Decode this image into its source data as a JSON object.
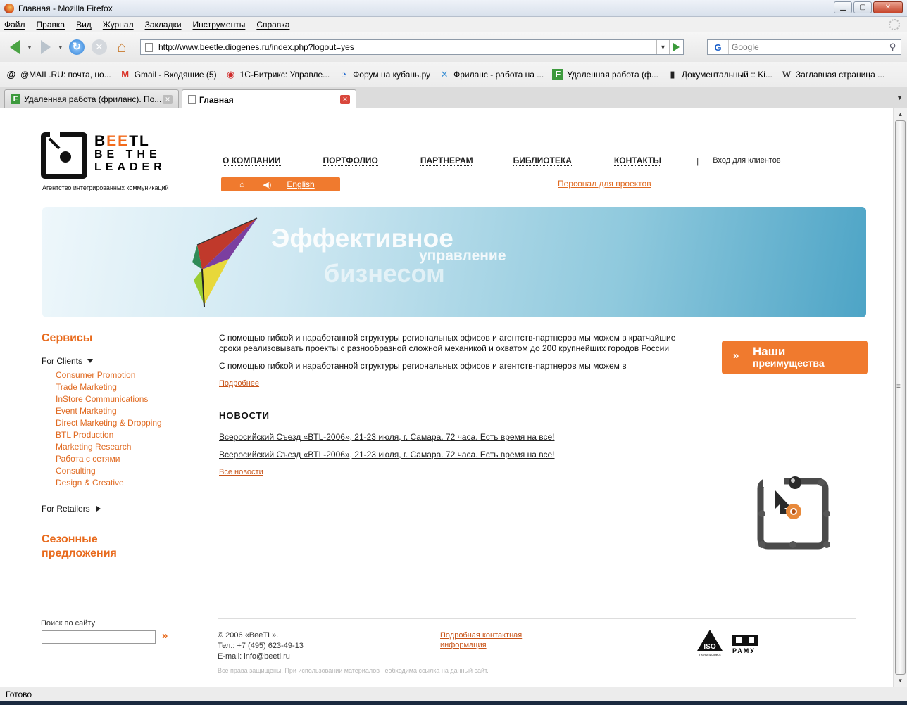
{
  "window": {
    "title": "Главная - Mozilla Firefox",
    "controls": [
      "▁",
      "▢",
      "✕"
    ]
  },
  "menu": [
    "Файл",
    "Правка",
    "Вид",
    "Журнал",
    "Закладки",
    "Инструменты",
    "Справка"
  ],
  "navigation": {
    "url": "http://www.beetle.diogenes.ru/index.php?logout=yes",
    "search_placeholder": "Google",
    "search_engine_glyph": "G"
  },
  "bookmarks": [
    {
      "label": "@MAIL.RU: почта, но...",
      "icon": "at-icon",
      "glyph": "@",
      "color": "#000000"
    },
    {
      "label": "Gmail - Входящие (5)",
      "icon": "gmail-icon",
      "glyph": "M",
      "color": "#d93025"
    },
    {
      "label": "1С-Битрикс: Управле...",
      "icon": "bitrix-icon",
      "glyph": "◉",
      "color": "#d02a2a"
    },
    {
      "label": "Форум на кубань.ру",
      "icon": "kuban-icon",
      "glyph": "◔",
      "color": "#2a6fcf"
    },
    {
      "label": "Фриланс - работа на ...",
      "icon": "freelance-icon",
      "glyph": "✕",
      "color": "#3b8fd4"
    },
    {
      "label": "Удаленная работа (ф...",
      "icon": "fl-icon",
      "glyph": "F",
      "color": "#3d9a3d"
    },
    {
      "label": "Документальный :: Ki...",
      "icon": "film-icon",
      "glyph": "▮",
      "color": "#222222"
    },
    {
      "label": "Заглавная страница ...",
      "icon": "wikipedia-icon",
      "glyph": "W",
      "color": "#333333"
    }
  ],
  "tabs": [
    {
      "label": "Удаленная работа (фриланс). По...",
      "glyph": "F"
    },
    {
      "label": "Главная",
      "glyph": ""
    }
  ],
  "status": "Готово",
  "site": {
    "logo": {
      "line1_pre": "B",
      "line1_orange": "EE",
      "line1_post": "TL",
      "line2": "BE THE",
      "line3": "LEADER",
      "tagline": "Агентство интегрированных коммуникаций"
    },
    "nav": [
      "О КОМПАНИИ",
      "ПОРТФОЛИО",
      "ПАРТНЕРАМ",
      "БИБЛИОТЕКА",
      "КОНТАКТЫ"
    ],
    "nav_separator": "|",
    "client_login": "Вход для клиентов",
    "lang": {
      "home_glyph": "⌂",
      "sound_glyph": "◀)",
      "english": "English"
    },
    "staff_link": "Персонал для проектов",
    "banner": {
      "line1": "Эффективное",
      "line2": "управление",
      "line3": "бизнесом"
    },
    "sidebar": {
      "services_title": "Сервисы",
      "for_clients": "For Clients",
      "services": [
        "Consumer Promotion",
        "Trade Marketing",
        "InStore Communications",
        "Event Marketing",
        "Direct Marketing & Dropping",
        "BTL Production",
        "Marketing Research",
        "Работа с сетями",
        "Consulting",
        "Design & Creative"
      ],
      "for_retailers": "For Retailers",
      "seasonal_title": "Сезонные предложения"
    },
    "main": {
      "para1": "С помощью гибкой и наработанной структуры региональных офисов и агентств-партнеров мы можем в кратчайшие сроки реализовывать проекты с разнообразной сложной механикой и охватом до 200 крупнейших городов России",
      "para2": "С помощью гибкой и наработанной структуры региональных офисов и агентств-партнеров мы можем в",
      "more": "Подробнее",
      "news_title": "НОВОСТИ",
      "news": [
        "Всеросийский Съезд «BTL-2006», 21-23 июля, г. Самара. 72 часа. Есть время на все!",
        "Всеросийский Съезд «BTL-2006», 21-23 июля, г. Самара. 72 часа. Есть время на все!"
      ],
      "all_news": "Все новости"
    },
    "advantages": {
      "chev": "»",
      "line1": "Наши",
      "line2": "преимущества"
    },
    "footer": {
      "search_label": "Поиск по сайту",
      "search_go": "»",
      "copyright": "© 2006 «BeeTL».",
      "phone": "Тел.: +7 (495) 623-49-13",
      "email": "E-mail: info@beetl.ru",
      "contact_link": "Подробная контактная информация",
      "rights": "Все права защищены. При использовании материалов необходима ссылка на данный сайт.",
      "iso_text": "ISO",
      "iso_sub": "ТехноПрогресс",
      "ramu_text": "РАМУ"
    }
  }
}
